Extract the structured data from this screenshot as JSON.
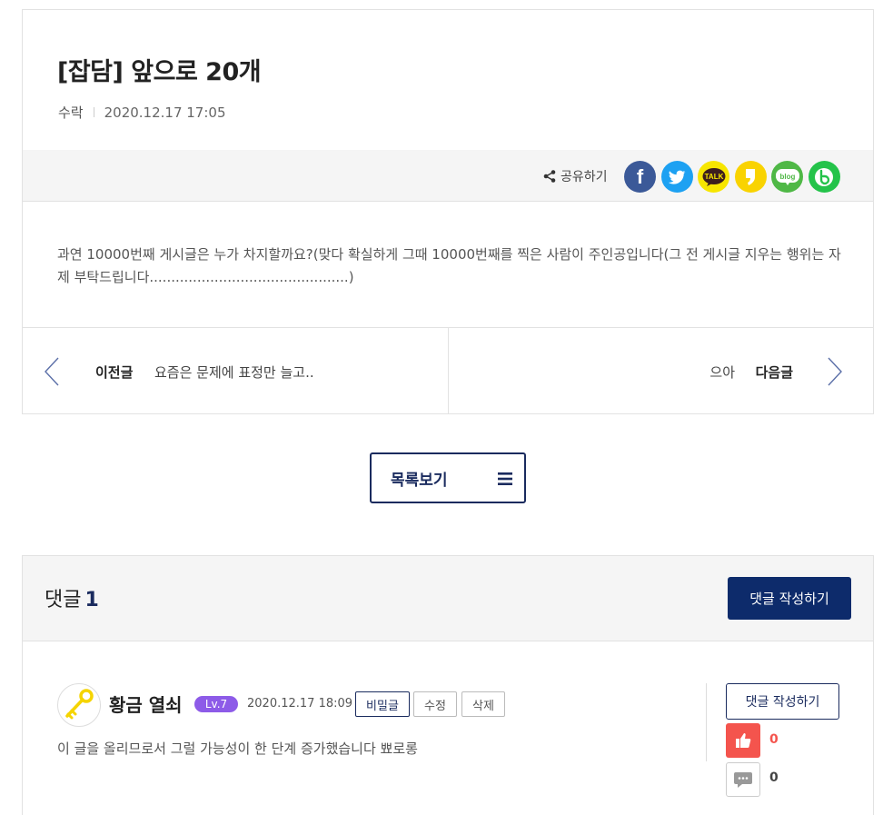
{
  "post": {
    "title": "[잡담] 앞으로 20개",
    "author": "수락",
    "date": "2020.12.17 17:05",
    "share_label": "공유하기",
    "share_icons": [
      "facebook-icon",
      "twitter-icon",
      "kakaotalk-icon",
      "kakaostory-icon",
      "naver-blog-icon",
      "band-icon"
    ],
    "share_texts": {
      "facebook": "f",
      "kakaotalk": "TALK",
      "blog": "blog"
    },
    "body": "과연 10000번째 게시글은 누가 차지할까요?(맞다 확실하게 그때 10000번째를 찍은 사람이 주인공입니다(그 전 게시글 지우는 행위는 자제 부탁드립니다..............................................)"
  },
  "nav": {
    "prev_label": "이전글",
    "prev_title": "요즘은 문제에 표정만 늘고..",
    "next_label": "다음글",
    "next_title": "으아"
  },
  "list_button": {
    "label": "목록보기"
  },
  "comments": {
    "title": "댓글",
    "count": "1",
    "write_label": "댓글 작성하기",
    "items": [
      {
        "name": "황금 열쇠",
        "level": "Lv.7",
        "date": "2020.12.17 18:09",
        "secret_label": "비밀글",
        "edit_label": "수정",
        "delete_label": "삭제",
        "text": "이 글을 올리므로서 그럴 가능성이 한 단계 증가했습니다 뾰로롱",
        "reply_label": "댓글 작성하기",
        "likes": "0",
        "replies": "0"
      }
    ]
  },
  "colors": {
    "navy": "#0d2b6b",
    "like_red": "#f4544d",
    "level_purple": "#8d5be8",
    "facebook": "#3b5998",
    "twitter": "#1da1f2",
    "kakao": "#f7e600",
    "blog": "#4fb846",
    "band": "#24c34a"
  }
}
